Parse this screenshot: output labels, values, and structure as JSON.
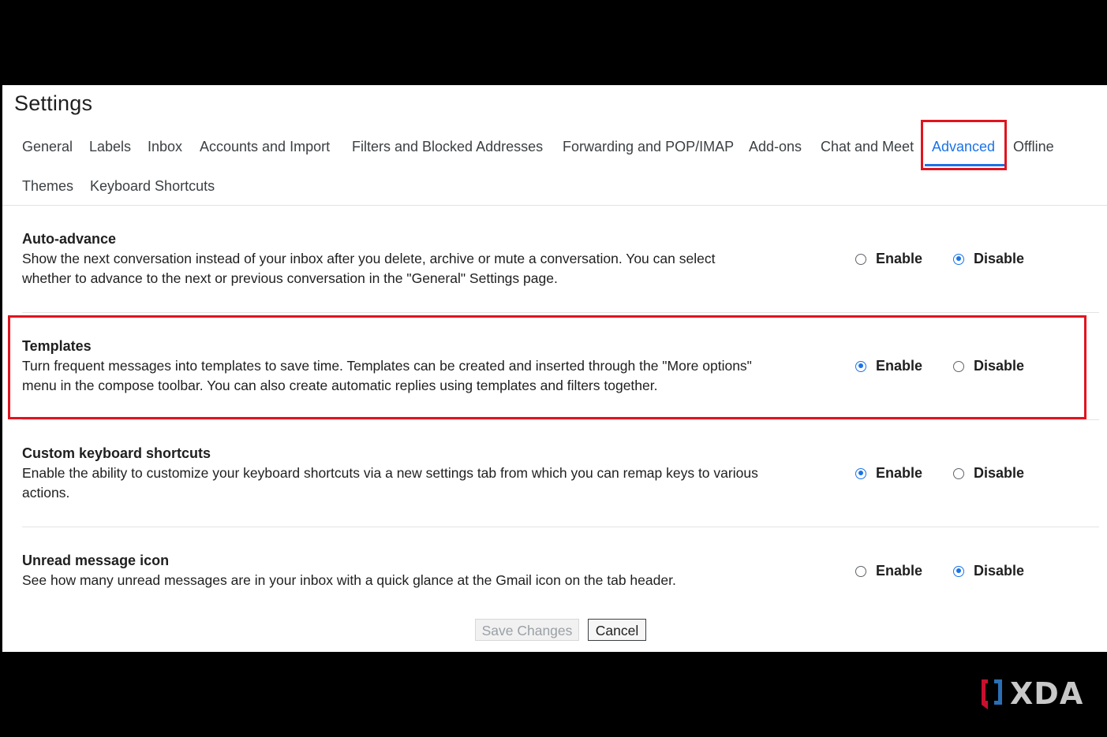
{
  "page_title": "Settings",
  "tabs": [
    {
      "label": "General",
      "active": false
    },
    {
      "label": "Labels",
      "active": false
    },
    {
      "label": "Inbox",
      "active": false
    },
    {
      "label": "Accounts and Import",
      "active": false
    },
    {
      "label": "Filters and Blocked Addresses",
      "active": false
    },
    {
      "label": "Forwarding and POP/IMAP",
      "active": false
    },
    {
      "label": "Add-ons",
      "active": false
    },
    {
      "label": "Chat and Meet",
      "active": false
    },
    {
      "label": "Advanced",
      "active": true
    },
    {
      "label": "Offline",
      "active": false
    },
    {
      "label": "Themes",
      "active": false
    },
    {
      "label": "Keyboard Shortcuts",
      "active": false
    }
  ],
  "sections": [
    {
      "title": "Auto-advance",
      "description": "Show the next conversation instead of your inbox after you delete, archive or mute a conversation. You can select whether to advance to the next or previous conversation in the \"General\" Settings page.",
      "enable_label": "Enable",
      "disable_label": "Disable",
      "selected": "Disable"
    },
    {
      "title": "Templates",
      "description": "Turn frequent messages into templates to save time. Templates can be created and inserted through the \"More options\" menu in the compose toolbar. You can also create automatic replies using templates and filters together.",
      "enable_label": "Enable",
      "disable_label": "Disable",
      "selected": "Enable"
    },
    {
      "title": "Custom keyboard shortcuts",
      "description": "Enable the ability to customize your keyboard shortcuts via a new settings tab from which you can remap keys to various actions.",
      "enable_label": "Enable",
      "disable_label": "Disable",
      "selected": "Enable"
    },
    {
      "title": "Unread message icon",
      "description": "See how many unread messages are in your inbox with a quick glance at the Gmail icon on the tab header.",
      "enable_label": "Enable",
      "disable_label": "Disable",
      "selected": "Disable"
    }
  ],
  "buttons": {
    "save_label": "Save Changes",
    "cancel_label": "Cancel"
  },
  "watermark": {
    "text": "XDA"
  },
  "colors": {
    "accent": "#1a73e8",
    "highlight": "#e0141e",
    "background": "#000000"
  }
}
